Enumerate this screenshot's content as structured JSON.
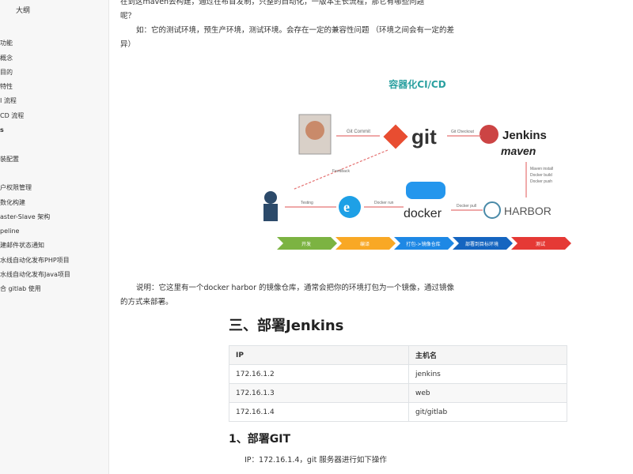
{
  "sidebar": {
    "title": "大纲",
    "items": [
      {
        "label": "",
        "bold": false
      },
      {
        "label": "功能",
        "bold": false
      },
      {
        "label": "概念",
        "bold": false
      },
      {
        "label": "目的",
        "bold": false
      },
      {
        "label": "特性",
        "bold": false
      },
      {
        "label": "I 流程",
        "bold": false
      },
      {
        "label": "CD 流程",
        "bold": false
      },
      {
        "label": "s",
        "bold": true
      },
      {
        "label": "",
        "bold": false
      },
      {
        "label": "装配置",
        "bold": false
      },
      {
        "label": "",
        "bold": false
      },
      {
        "label": "户权限管理",
        "bold": false
      },
      {
        "label": "数化构建",
        "bold": false
      },
      {
        "label": "aster-Slave 架构",
        "bold": false
      },
      {
        "label": "peline",
        "bold": false
      },
      {
        "label": "建邮件状态通知",
        "bold": false
      },
      {
        "label": "水线自动化发布PHP项目",
        "bold": false
      },
      {
        "label": "水线自动化发布Java项目",
        "bold": false
      },
      {
        "label": "合 gitlab 使用",
        "bold": false
      }
    ]
  },
  "content": {
    "para_top_line1": "在到这maven去构建，通过在布首发制，只整的自动化，一版本生长流程，那它有哪些问题",
    "para_top_line2": "呢？",
    "para_env": "如：它的测试环境，预生产环境，测试环境。会存在一定的兼容性问题 （环境之间会有一定的差异）",
    "figure_title": "容器化CI/CD",
    "figure_labels": {
      "git": "git",
      "jenkins": "Jenkins",
      "maven": "maven",
      "docker": "docker",
      "harbor": "HARBOR",
      "git_commit": "Git Commit",
      "git_checkout": "Git Checkout",
      "feedback": "Feedback",
      "testing": "Testing",
      "docker_run": "Docker run",
      "docker_pull": "Docker pull",
      "maven_steps": [
        "Maven install",
        "Docker build",
        "Docker push"
      ],
      "stages": [
        "开发",
        "编译",
        "打包->镜像仓库",
        "部署到目标环境",
        "测试"
      ]
    },
    "para_note": "说明：它这里有一个docker harbor 的镜像仓库，通常会把你的环境打包为一个镜像，通过镜像的方式来部署。",
    "h2": "三、部署Jenkins",
    "table": {
      "headers": [
        "IP",
        "主机名"
      ],
      "rows": [
        [
          "172.16.1.2",
          "jenkins"
        ],
        [
          "172.16.1.3",
          "web"
        ],
        [
          "172.16.1.4",
          "git/gitlab"
        ]
      ]
    },
    "h3": "1、部署GIT",
    "para_bottom": "IP：172.16.1.4，git 服务器进行如下操作"
  },
  "colors": {
    "git_red": "#e84d31",
    "docker_blue": "#2496ed",
    "stage_colors": [
      "#7cb342",
      "#f9a825",
      "#1e88e5",
      "#1565c0",
      "#e53935"
    ]
  }
}
